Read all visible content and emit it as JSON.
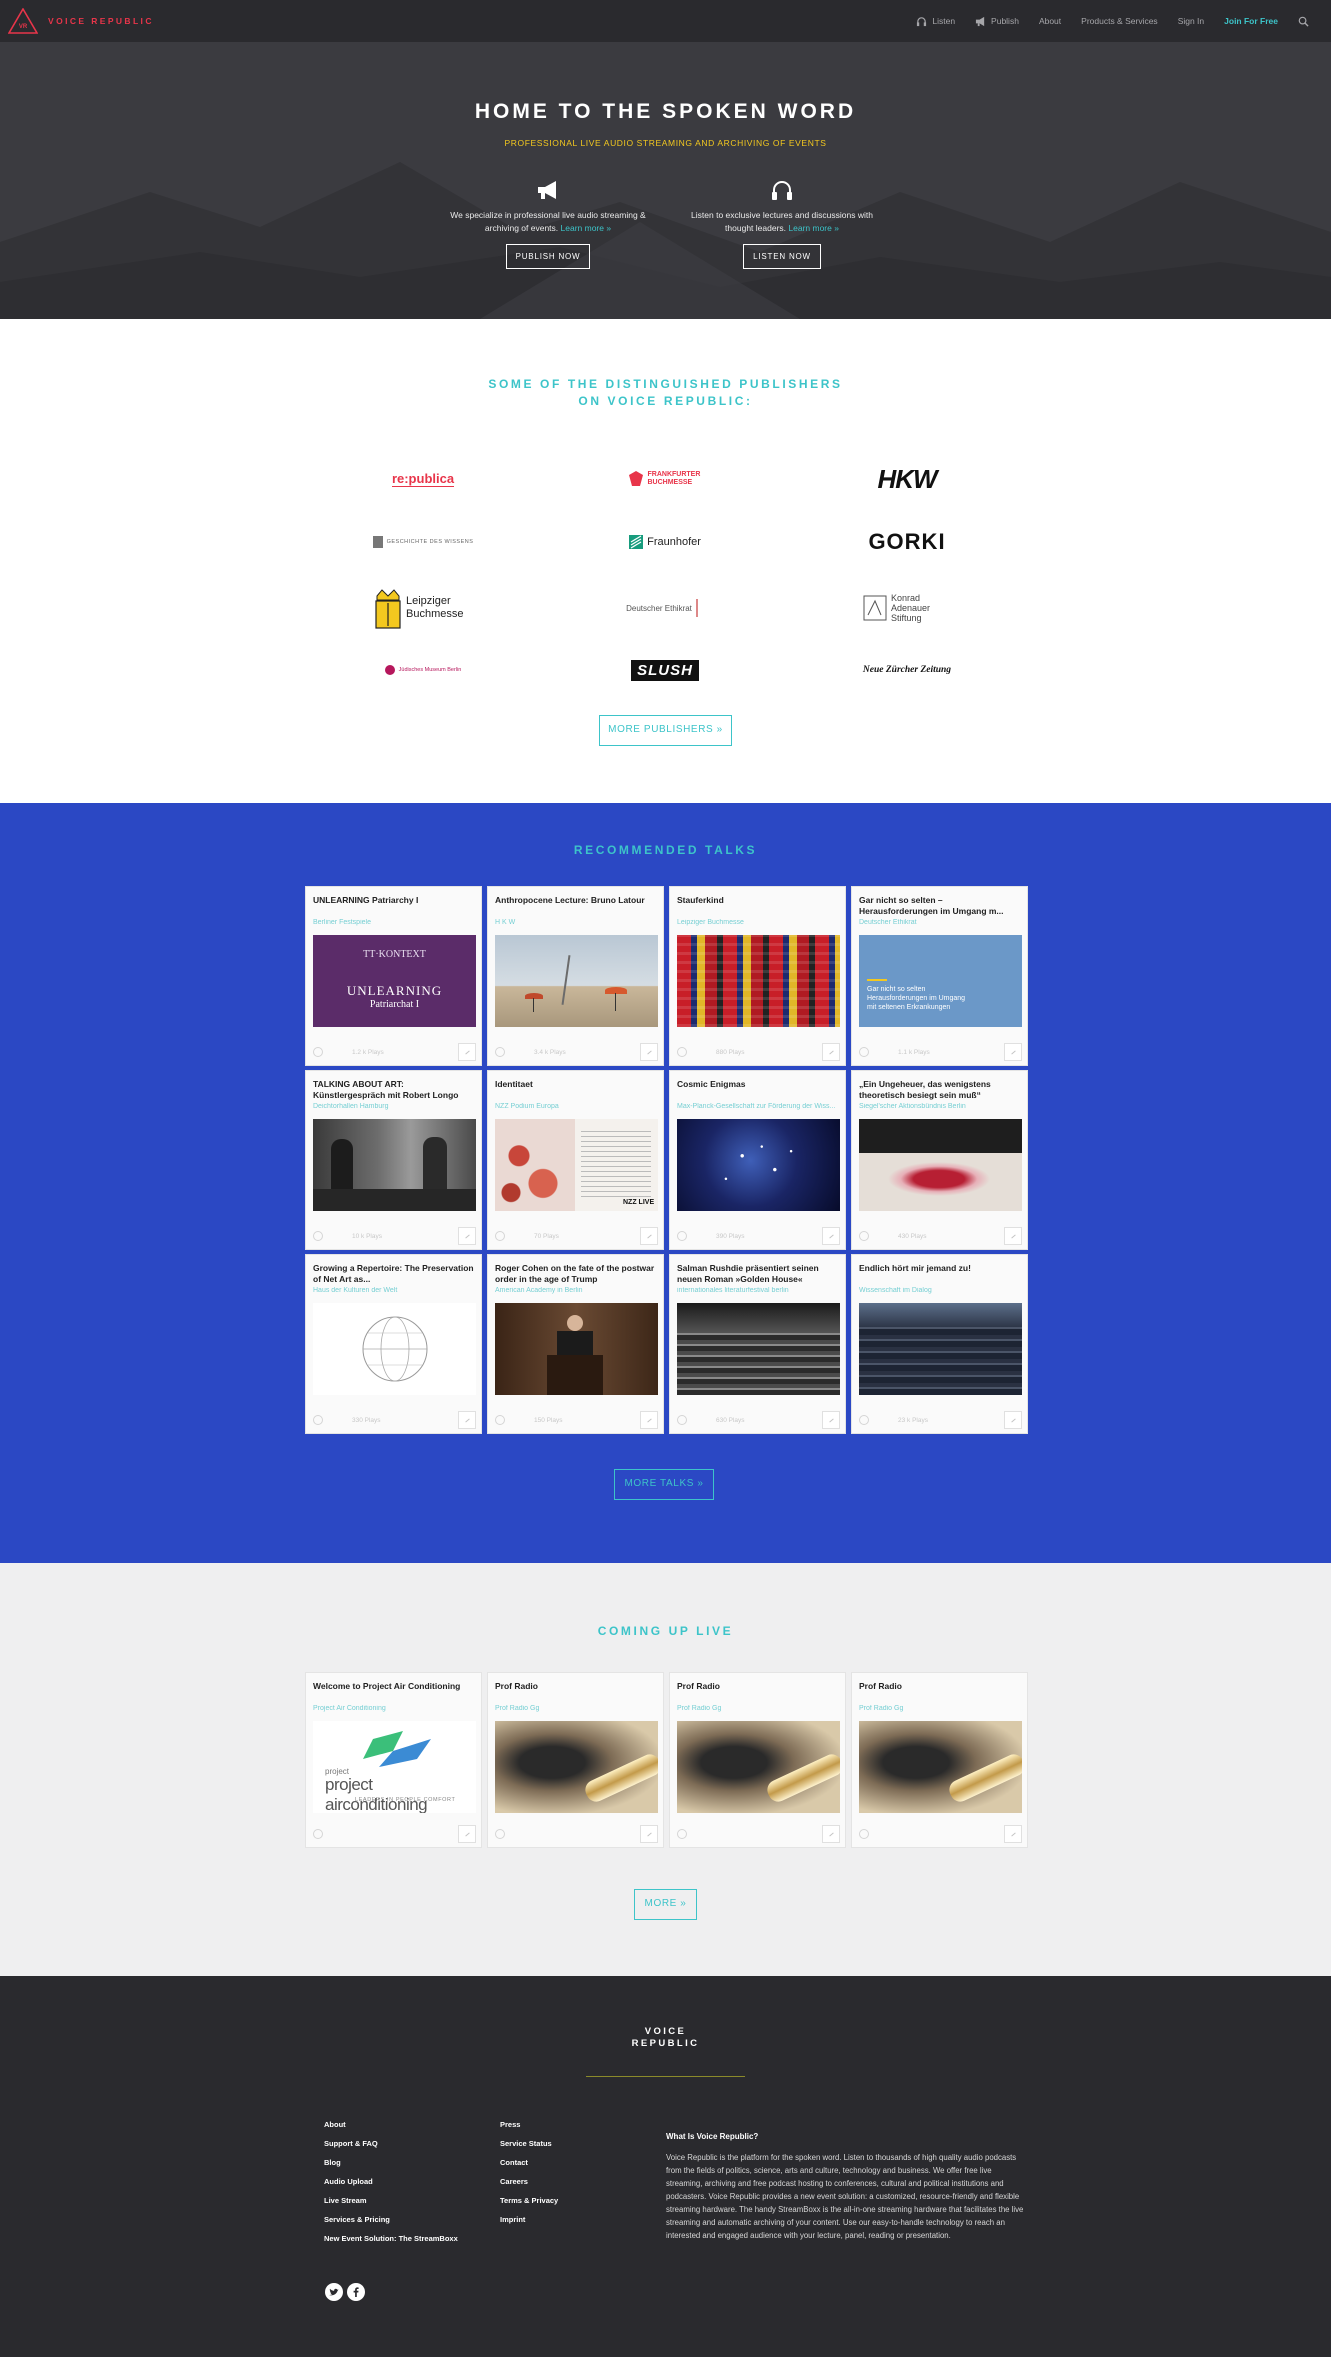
{
  "nav": {
    "logo_text": "VOICE REPUBLIC",
    "links": [
      {
        "label": "Listen",
        "icon": "headphones-icon"
      },
      {
        "label": "Publish",
        "icon": "megaphone-icon"
      },
      {
        "label": "About"
      },
      {
        "label": "Products & Services"
      },
      {
        "label": "Sign In"
      },
      {
        "label": "Join For Free"
      }
    ]
  },
  "hero": {
    "title": "HOME TO THE SPOKEN WORD",
    "subtitle": "PROFESSIONAL LIVE AUDIO STREAMING AND ARCHIVING OF EVENTS",
    "publish": {
      "text": "We specialize in professional live audio streaming & archiving of events.",
      "link": "Learn more »",
      "button": "PUBLISH NOW"
    },
    "listen": {
      "text": "Listen to exclusive lectures and discussions with thought leaders.",
      "link": "Learn more »",
      "button": "LISTEN NOW"
    }
  },
  "publishers": {
    "title_line1": "SOME OF THE DISTINGUISHED PUBLISHERS",
    "title_line2": "ON VOICE REPUBLIC:",
    "logos": [
      "re:publica",
      "FRANKFURTER BUCHMESSE",
      "HKW",
      "GESCHICHTE DES WISSENS",
      "Fraunhofer",
      "GORKI",
      "Leipziger Buchmesse",
      "Deutscher Ethikrat",
      "Konrad Adenauer Stiftung",
      "Jüdisches Museum Berlin",
      "SLUSH",
      "Neue Zürcher Zeitung"
    ],
    "more": "MORE PUBLISHERS »"
  },
  "recommended": {
    "title": "RECOMMENDED TALKS",
    "talks": [
      {
        "title": "UNLEARNING Patriarchy I",
        "publisher": "Berliner Festspiele",
        "plays": "1.2 k Plays"
      },
      {
        "title": "Anthropocene Lecture: Bruno Latour",
        "publisher": "H K W",
        "plays": "3.4 k Plays"
      },
      {
        "title": "Stauferkind",
        "publisher": "Leipziger Buchmesse",
        "plays": "880 Plays"
      },
      {
        "title": "Gar nicht so selten – Herausforderungen im Umgang m...",
        "publisher": "Deutscher Ethikrat",
        "plays": "1.1 k Plays"
      },
      {
        "title": "TALKING ABOUT ART: Künstlergespräch mit Robert Longo",
        "publisher": "Deichtorhallen Hamburg",
        "plays": "10 k Plays"
      },
      {
        "title": "Identitaet",
        "publisher": "NZZ Podium Europa",
        "plays": "70 Plays"
      },
      {
        "title": "Cosmic Enigmas",
        "publisher": "Max-Planck-Gesellschaft zur Förderung der Wiss...",
        "plays": "390 Plays"
      },
      {
        "title": "„Ein Ungeheuer, das wenigstens theoretisch besiegt sein muß“",
        "publisher": "Siegel'scher Aktionsbündnis Berlin",
        "plays": "430 Plays"
      },
      {
        "title": "Growing a Repertoire: The Preservation of Net Art as...",
        "publisher": "Haus der Kulturen der Welt",
        "plays": "330 Plays"
      },
      {
        "title": "Roger Cohen on the fate of the postwar order in the age of Trump",
        "publisher": "American Academy in Berlin",
        "plays": "150 Plays"
      },
      {
        "title": "Salman Rushdie präsentiert seinen neuen Roman »Golden House«",
        "publisher": "internationales literaturfestival berlin",
        "plays": "630 Plays"
      },
      {
        "title": "Endlich hört mir jemand zu!",
        "publisher": "Wissenschaft im Dialog",
        "plays": "23 k Plays"
      }
    ],
    "more": "MORE TALKS »"
  },
  "live": {
    "title": "COMING UP LIVE",
    "events": [
      {
        "title": "Welcome to Project Air Conditioning",
        "publisher": "Project Air Conditioning",
        "img_text": "project airconditioning",
        "img_sub": "LEADERS IN PEOPLE COMFORT"
      },
      {
        "title": "Prof Radio",
        "publisher": "Prof Radio Gg"
      },
      {
        "title": "Prof Radio",
        "publisher": "Prof Radio Gg"
      },
      {
        "title": "Prof Radio",
        "publisher": "Prof Radio Gg"
      }
    ],
    "more": "MORE »"
  },
  "footer": {
    "logo_line1": "VOICE",
    "logo_line2": "REPUBLIC",
    "col1": [
      "About",
      "Support & FAQ",
      "Blog",
      "Audio Upload",
      "Live Stream",
      "Services & Pricing",
      "New Event Solution: The StreamBoxx"
    ],
    "col2": [
      "Press",
      "Service Status",
      "Contact",
      "Careers",
      "Terms & Privacy",
      "Imprint"
    ],
    "about_heading": "What Is Voice Republic?",
    "about_text": "Voice Republic is the platform for the spoken word. Listen to thousands of high quality audio podcasts from the fields of politics, science, arts and culture, technology and business. We offer free live streaming, archiving and free podcast hosting to conferences, cultural and political institutions and podcasters. Voice Republic provides a new event solution: a customized, resource-friendly and flexible streaming hardware. The handy StreamBoxx is the all-in-one streaming hardware that facilitates the live streaming and automatic archiving of your content. Use our easy-to-handle technology to reach an interested and engaged audience with your lecture, panel, reading or presentation."
  },
  "colors": {
    "accent": "#3dc4c9",
    "brand_red": "#e8354a",
    "hero_yellow": "#f3c81f",
    "recommended_bg": "#2b48c4",
    "dark": "#2a2a2e"
  }
}
